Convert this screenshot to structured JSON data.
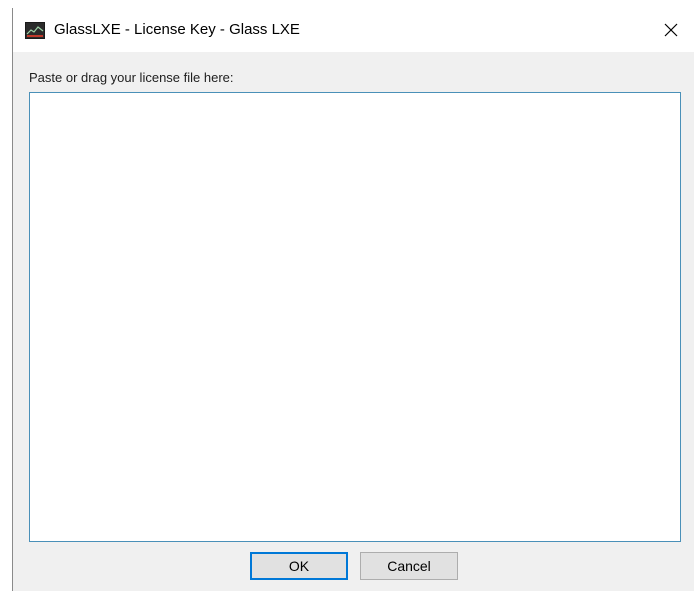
{
  "window": {
    "title": "GlassLXE - License Key - Glass LXE",
    "app_icon": "glasslxe-app-icon",
    "close_icon": "close-icon"
  },
  "dialog": {
    "prompt_label": "Paste or drag your license file here:",
    "license_text_value": "",
    "ok_label": "OK",
    "cancel_label": "Cancel"
  },
  "colors": {
    "default_button_border": "#0078d7",
    "textarea_border": "#4a90b8",
    "dialog_background": "#f0f0f0"
  }
}
